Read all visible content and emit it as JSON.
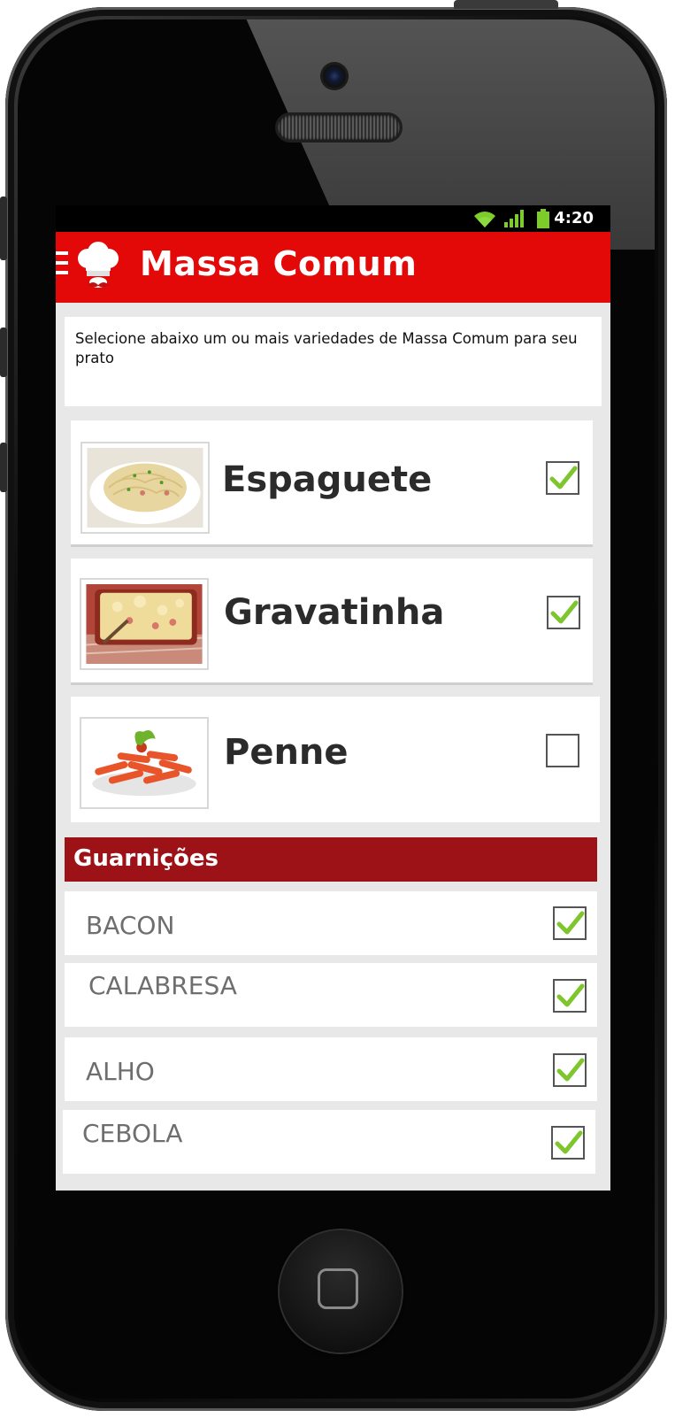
{
  "status_bar": {
    "time": "4:20"
  },
  "header": {
    "title": "Massa Comum",
    "color": "#e30909"
  },
  "intro": {
    "text": "Selecione abaixo um ou mais variedades de Massa Comum para seu prato"
  },
  "pastas": [
    {
      "name": "Espaguete",
      "checked": true,
      "image": "spaghetti-image"
    },
    {
      "name": "Gravatinha",
      "checked": true,
      "image": "farfalle-image"
    },
    {
      "name": "Penne",
      "checked": false,
      "image": "penne-image"
    }
  ],
  "garnishes": {
    "title": "Guarnições",
    "color": "#9c1217",
    "items": [
      {
        "label": "BACON",
        "checked": true
      },
      {
        "label": "CALABRESA",
        "checked": true
      },
      {
        "label": "ALHO",
        "checked": true
      },
      {
        "label": "CEBOLA",
        "checked": true
      }
    ]
  },
  "check_color": "#7fc62e"
}
